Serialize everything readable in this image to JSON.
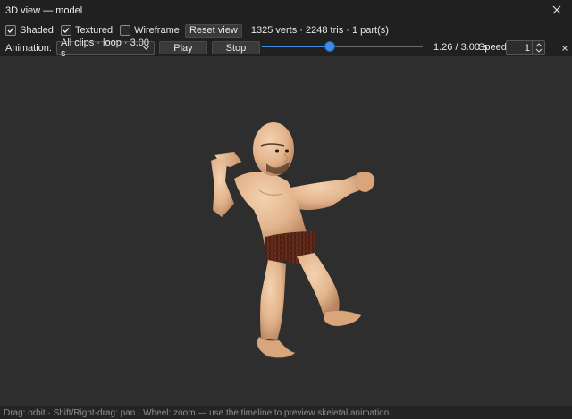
{
  "window": {
    "title": "3D view — model",
    "close_icon": "close-icon"
  },
  "display_options": {
    "shaded": {
      "label": "Shaded",
      "checked": true
    },
    "textured": {
      "label": "Textured",
      "checked": true
    },
    "wireframe": {
      "label": "Wireframe",
      "checked": false
    },
    "reset_view_label": "Reset view",
    "mesh_stats": "1325 verts · 2248 tris · 1 part(s)"
  },
  "animation": {
    "label": "Animation:",
    "selected_clip": "All clips · loop · 3.00 s",
    "play_label": "Play",
    "stop_label": "Stop",
    "timeline_position": 0.42,
    "time_readout": "1.26 / 3.00 s",
    "speed_label": "Speed:",
    "speed_value": "1",
    "clear_icon": "close-small-icon"
  },
  "status_hint": "Drag: orbit · Shift/Right-drag: pan · Wheel: zoom — use the timeline to preview skeletal animation",
  "colors": {
    "accent": "#3d8ee0",
    "skin": "#e2b48c",
    "loincloth": "#6b2f1e",
    "viewport_bg": "#2e2e2e"
  }
}
